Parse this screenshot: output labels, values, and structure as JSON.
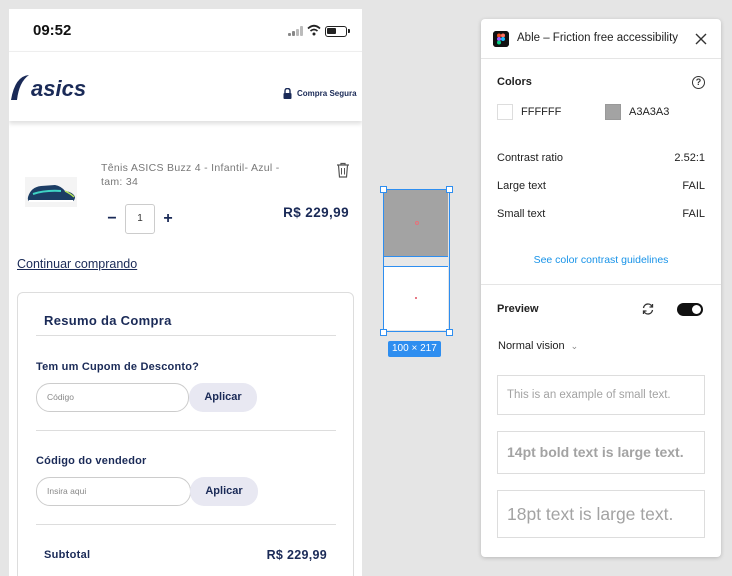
{
  "phone": {
    "status_time": "09:52",
    "brand": "asics",
    "secure_label": "Compra Segura",
    "product": {
      "name": "Tênis ASICS Buzz 4 - Infantil- Azul - tam: 34",
      "quantity": "1",
      "minus": "−",
      "plus": "+",
      "price": "R$ 229,99"
    },
    "continue_link": "Continuar comprando",
    "summary": {
      "title": "Resumo da Compra",
      "coupon_label": "Tem um Cupom de Desconto?",
      "coupon_placeholder": "Código",
      "apply_label": "Aplicar",
      "seller_label": "Código do vendedor",
      "seller_placeholder": "Insira aqui",
      "apply_label_2": "Aplicar",
      "subtotal_label": "Subtotal",
      "subtotal_value": "R$ 229,99"
    }
  },
  "canvas": {
    "dimension_badge": "100 × 217"
  },
  "plugin": {
    "title": "Able – Friction free accessibility",
    "colors_heading": "Colors",
    "color_1": {
      "hex_label": "FFFFFF",
      "value": "#FFFFFF"
    },
    "color_2": {
      "hex_label": "A3A3A3",
      "value": "#A3A3A3"
    },
    "contrast_label": "Contrast ratio",
    "contrast_value": "2.52:1",
    "large_text_label": "Large text",
    "large_text_value": "FAIL",
    "small_text_label": "Small text",
    "small_text_value": "FAIL",
    "guidelines_link": "See color contrast guidelines",
    "preview_heading": "Preview",
    "preview_toggle_on": true,
    "vision_mode": "Normal vision",
    "samples": {
      "small": "This is an example of small text.",
      "bold": "14pt bold text is large text.",
      "large": "18pt text is large text."
    }
  },
  "colors": {
    "brand_navy": "#1A2A57",
    "selection_blue": "#2E8EF0",
    "link_blue": "#1893E8"
  }
}
